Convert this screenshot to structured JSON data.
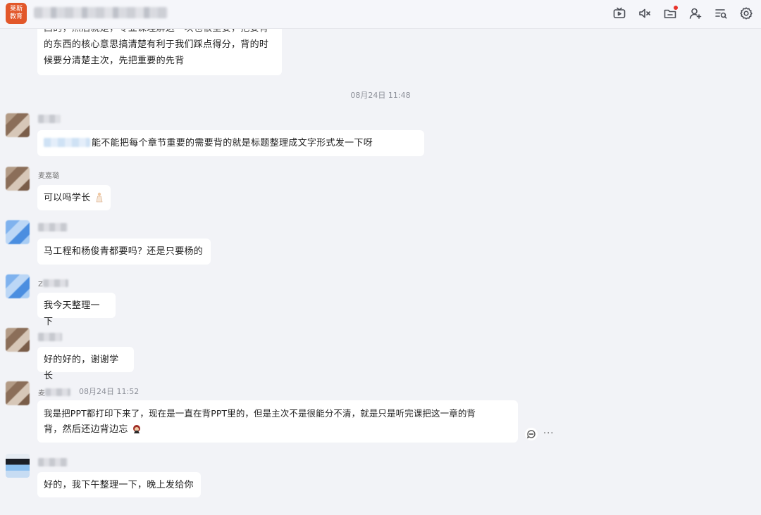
{
  "header": {
    "logo_text": "莱斯\n教育",
    "icons": [
      "tv-icon",
      "speaker-icon",
      "folder-icon",
      "add-user-icon",
      "search-list-icon",
      "gear-icon"
    ]
  },
  "messages": [
    {
      "lines": [
        "西的，然后就是，专业课理解这一块也很重要，把要背",
        "的东西的核心意思搞清楚有利于我们踩点得分，背的时",
        "候要分清楚主次，先把重要的先背"
      ]
    },
    {
      "time": "08月24日 11:48"
    },
    {
      "text": "能不能把每个章节重要的需要背的就是标题整理成文字形式发一下呀"
    },
    {
      "sender": "麦嘉璐",
      "text": "可以吗学长"
    },
    {
      "text": "马工程和杨俊青都要吗？还是只要杨的"
    },
    {
      "sender_prefix": "Z",
      "text": "我今天整理一下"
    },
    {
      "text": "好的好的，谢谢学长"
    },
    {
      "sender_prefix": "麦",
      "time": "08月24日 11:52",
      "lines": [
        "我是把PPT都打印下来了，现在是一直在背PPT里的，但是主次不是很能分不清，就是只是听完课把这一章的背",
        "背，然后还边背边忘"
      ]
    },
    {
      "text": "好的，我下午整理一下，晚上发给你"
    }
  ],
  "actions": {
    "more": "···"
  },
  "colors": {
    "logo": "#e2572a",
    "background": "#f2f3f7",
    "bubble": "#ffffff",
    "notification_dot": "#e8332a"
  }
}
